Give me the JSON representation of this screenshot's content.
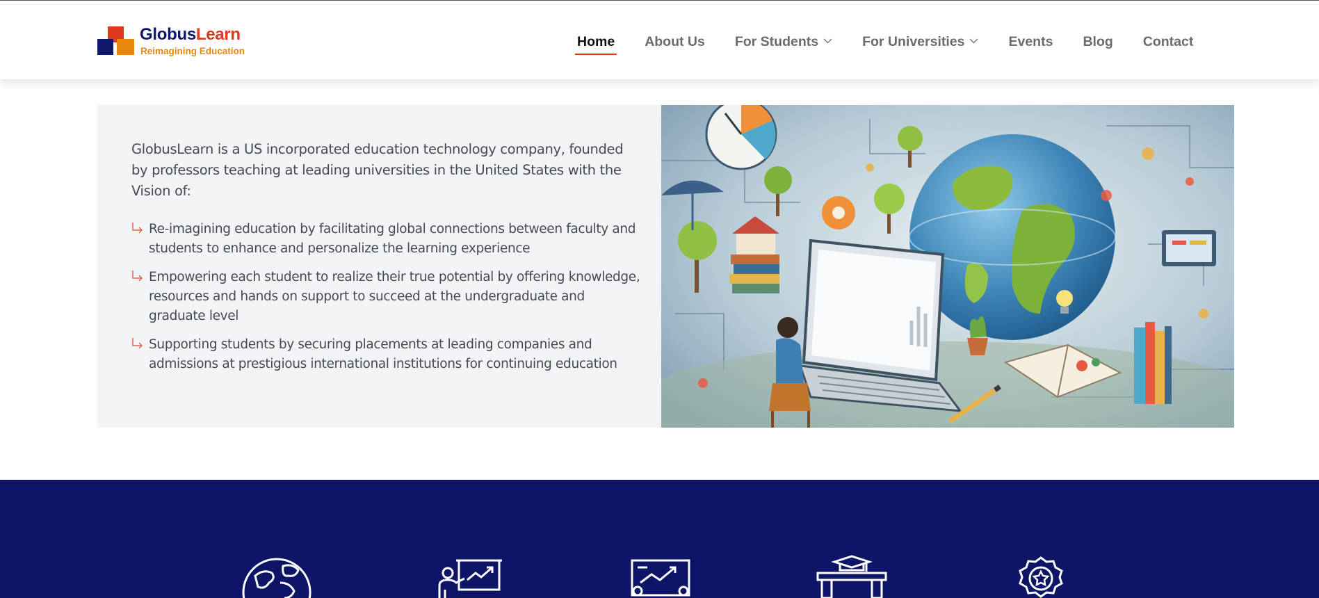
{
  "brand": {
    "name_part1": "Globus",
    "name_part2": "Learn",
    "tagline": "Reimagining Education",
    "colors": {
      "navy": "#10186b",
      "red": "#e0381a",
      "orange": "#e8890c"
    }
  },
  "nav": {
    "items": [
      {
        "label": "Home",
        "active": true
      },
      {
        "label": "About Us"
      },
      {
        "label": "For Students",
        "has_dropdown": true
      },
      {
        "label": "For Universities",
        "has_dropdown": true
      },
      {
        "label": "Events"
      },
      {
        "label": "Blog"
      },
      {
        "label": "Contact"
      }
    ]
  },
  "intro": {
    "paragraph": "GlobusLearn is a US incorporated education technology company, founded by professors teaching at leading universities in the United States with the Vision of:",
    "vision": [
      "Re-imagining education by facilitating global connections between faculty and students to enhance and personalize the learning experience",
      "Empowering each student to realize their true potential by offering knowledge, resources and hands on support to succeed at the undergraduate and graduate level",
      "Supporting students by securing placements at leading companies and admissions at prestigious international institutions for continuing education"
    ],
    "bullet_icon": "arrow-return-right-icon"
  },
  "features": {
    "background": "#0e1566",
    "icons": [
      "globe-icon",
      "presentation-icon",
      "growth-chart-icon",
      "graduation-desk-icon",
      "award-badge-icon"
    ]
  }
}
